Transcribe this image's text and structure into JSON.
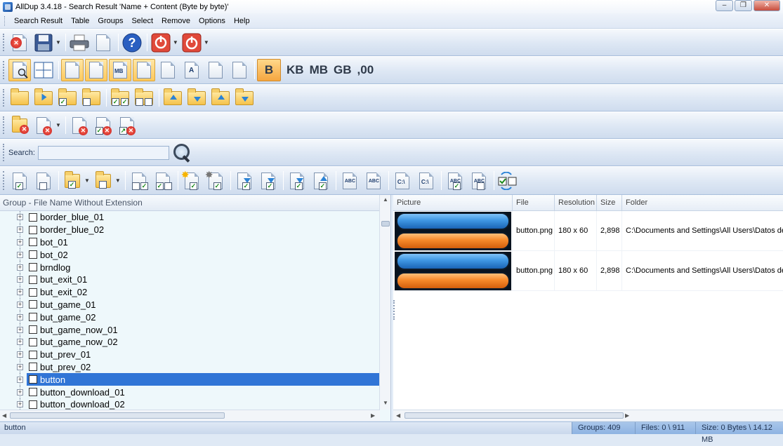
{
  "window": {
    "title": "AllDup 3.4.18 - Search Result 'Name + Content (Byte by byte)'",
    "controls": [
      "–",
      "❐",
      "✕"
    ]
  },
  "menu": [
    "Search Result",
    "Table",
    "Groups",
    "Select",
    "Remove",
    "Options",
    "Help"
  ],
  "size_units": {
    "bytes": "B",
    "kb": "KB",
    "mb": "MB",
    "gb": "GB",
    "decimals": ",00"
  },
  "icons": {
    "folder_path": "C:\\",
    "abc": "ABC",
    "mb": "MB",
    "letter_a": "A"
  },
  "search": {
    "label": "Search:",
    "value": ""
  },
  "left_pane": {
    "header": "Group - File Name Without Extension",
    "items": [
      {
        "label": "border_blue_01"
      },
      {
        "label": "border_blue_02"
      },
      {
        "label": "bot_01"
      },
      {
        "label": "bot_02"
      },
      {
        "label": "brndlog"
      },
      {
        "label": "but_exit_01"
      },
      {
        "label": "but_exit_02"
      },
      {
        "label": "but_game_01"
      },
      {
        "label": "but_game_02"
      },
      {
        "label": "but_game_now_01"
      },
      {
        "label": "but_game_now_02"
      },
      {
        "label": "but_prev_01"
      },
      {
        "label": "but_prev_02"
      },
      {
        "label": "button",
        "selected": true
      },
      {
        "label": "button_download_01"
      },
      {
        "label": "button_download_02"
      }
    ]
  },
  "right_pane": {
    "columns": [
      "Picture",
      "File",
      "Resolution",
      "Size",
      "Folder"
    ],
    "rows": [
      {
        "file": "button.png",
        "resolution": "180 x 60",
        "size": "2,898",
        "folder": "C:\\Documents and Settings\\All Users\\Datos de pro"
      },
      {
        "file": "button.png",
        "resolution": "180 x 60",
        "size": "2,898",
        "folder": "C:\\Documents and Settings\\All Users\\Datos de pro"
      }
    ]
  },
  "status": {
    "left": "button",
    "groups": "Groups: 409",
    "files": "Files: 0 \\ 911",
    "size": "Size: 0 Bytes \\ 14.12 MB"
  },
  "colors": {
    "selection": "#3075d6",
    "accent_orange": "#f5a640",
    "toolbar_bg": "#dde7f4"
  }
}
